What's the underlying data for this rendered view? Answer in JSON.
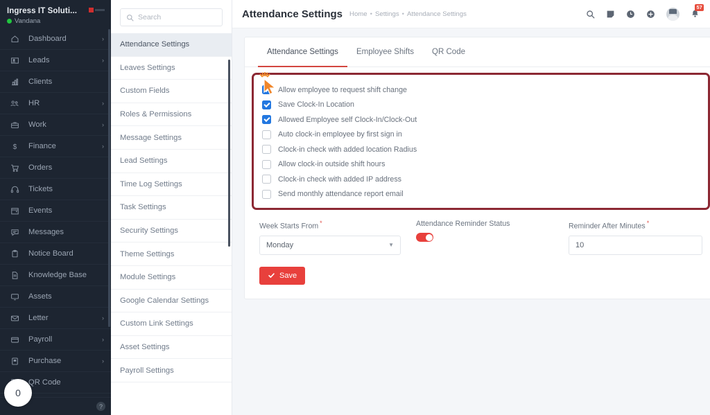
{
  "brand": {
    "company": "Ingress IT Soluti...",
    "user": "Vandana",
    "status_icon": "online-dot-icon",
    "logo_icon": "company-logo-icon"
  },
  "sidebar": {
    "scrollbar_icon": "vertical-scrollbar",
    "help_icon": "question-mark-icon",
    "floating_counter": "0",
    "items": [
      {
        "label": "Dashboard",
        "icon": "home-icon",
        "chevron": "›"
      },
      {
        "label": "Leads",
        "icon": "contact-card-icon",
        "chevron": "›"
      },
      {
        "label": "Clients",
        "icon": "building-icon",
        "chevron": ""
      },
      {
        "label": "HR",
        "icon": "people-icon",
        "chevron": "›"
      },
      {
        "label": "Work",
        "icon": "briefcase-icon",
        "chevron": "›"
      },
      {
        "label": "Finance",
        "icon": "dollar-icon",
        "chevron": "›"
      },
      {
        "label": "Orders",
        "icon": "cart-icon",
        "chevron": ""
      },
      {
        "label": "Tickets",
        "icon": "headset-icon",
        "chevron": ""
      },
      {
        "label": "Events",
        "icon": "calendar-icon",
        "chevron": ""
      },
      {
        "label": "Messages",
        "icon": "chat-icon",
        "chevron": ""
      },
      {
        "label": "Notice Board",
        "icon": "clipboard-icon",
        "chevron": ""
      },
      {
        "label": "Knowledge Base",
        "icon": "document-icon",
        "chevron": ""
      },
      {
        "label": "Assets",
        "icon": "monitor-icon",
        "chevron": ""
      },
      {
        "label": "Letter",
        "icon": "envelope-icon",
        "chevron": "›"
      },
      {
        "label": "Payroll",
        "icon": "wallet-icon",
        "chevron": "›"
      },
      {
        "label": "Purchase",
        "icon": "purchase-icon",
        "chevron": "›"
      },
      {
        "label": "QR Code",
        "icon": "qrcode-icon",
        "chevron": ""
      }
    ]
  },
  "submenu": {
    "search": {
      "value": "",
      "placeholder": "Search",
      "icon": "search-icon"
    },
    "items": [
      {
        "label": "Attendance Settings",
        "active": true
      },
      {
        "label": "Leaves Settings",
        "active": false
      },
      {
        "label": "Custom Fields",
        "active": false
      },
      {
        "label": "Roles & Permissions",
        "active": false
      },
      {
        "label": "Message Settings",
        "active": false
      },
      {
        "label": "Lead Settings",
        "active": false
      },
      {
        "label": "Time Log Settings",
        "active": false
      },
      {
        "label": "Task Settings",
        "active": false
      },
      {
        "label": "Security Settings",
        "active": false
      },
      {
        "label": "Theme Settings",
        "active": false
      },
      {
        "label": "Module Settings",
        "active": false
      },
      {
        "label": "Google Calendar Settings",
        "active": false
      },
      {
        "label": "Custom Link Settings",
        "active": false
      },
      {
        "label": "Asset Settings",
        "active": false
      },
      {
        "label": "Payroll Settings",
        "active": false
      }
    ]
  },
  "header": {
    "title": "Attendance Settings",
    "breadcrumb": [
      "Home",
      "Settings",
      "Attendance Settings"
    ],
    "separator": "•",
    "icons": [
      {
        "name": "search-icon"
      },
      {
        "name": "note-icon"
      },
      {
        "name": "clock-icon"
      },
      {
        "name": "plus-circle-icon"
      }
    ],
    "avatar_icon": "user-avatar",
    "bell_icon": "bell-icon",
    "notification_count": "57",
    "power_icon": "power-icon"
  },
  "main": {
    "tabs": [
      {
        "label": "Attendance Settings",
        "active": true
      },
      {
        "label": "Employee Shifts",
        "active": false
      },
      {
        "label": "QR Code",
        "active": false
      }
    ],
    "checkboxes": [
      {
        "label": "Allow employee to request shift change",
        "checked": true
      },
      {
        "label": "Save Clock-In Location",
        "checked": true
      },
      {
        "label": "Allowed Employee self Clock-In/Clock-Out",
        "checked": true
      },
      {
        "label": "Auto clock-in employee by first sign in",
        "checked": false
      },
      {
        "label": "Clock-in check with added location Radius",
        "checked": false
      },
      {
        "label": "Allow clock-in outside shift hours",
        "checked": false
      },
      {
        "label": "Clock-in check with added IP address",
        "checked": false
      },
      {
        "label": "Send monthly attendance report email",
        "checked": false
      }
    ],
    "cursor_icon": "click-cursor-icon",
    "fields": {
      "week_starts": {
        "label": "Week Starts From",
        "required": "*",
        "value": "Monday",
        "caret_icon": "chevron-down-icon"
      },
      "reminder_status": {
        "label": "Attendance Reminder Status",
        "enabled": true
      },
      "reminder_minutes": {
        "label": "Reminder After Minutes",
        "required": "*",
        "value": "10",
        "placeholder": ""
      }
    },
    "save_button": {
      "label": "Save",
      "icon": "check-icon"
    }
  },
  "colors": {
    "accent_red": "#e8403c",
    "highlight_border": "#8c2833",
    "checkbox_blue": "#2277e0",
    "sidebar_bg": "#1d2531"
  }
}
